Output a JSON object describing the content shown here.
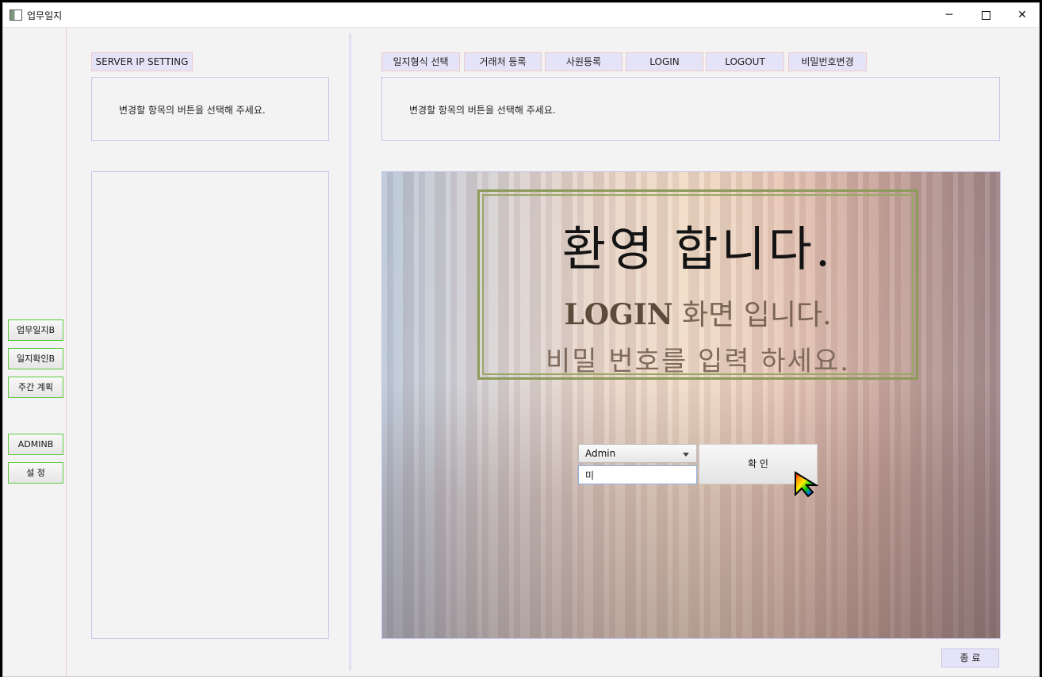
{
  "window": {
    "title": "업무일지"
  },
  "left_rail": {
    "buttons": [
      "업무일지B",
      "일지확인B",
      "주간 계획",
      "ADMINB",
      "설    정"
    ]
  },
  "server_section": {
    "button_label": "SERVER IP SETTING",
    "info_text": "변경할 항목의 버튼을 선택해 주세요."
  },
  "tabs": [
    "일지형식 선택",
    "거래처 등록",
    "사원등록",
    "LOGIN",
    "LOGOUT",
    "비밀번호변경"
  ],
  "main_info": {
    "text": "변경할 항목의 버튼을 선택해 주세요."
  },
  "welcome": {
    "title": "환영 합니다.",
    "line1_strong": "LOGIN",
    "line1_rest": " 화면 입니다.",
    "line2": "비밀 번호를 입력 하세요."
  },
  "login_form": {
    "user_selected": "Admin",
    "password_value": "미",
    "confirm_label": "확 인"
  },
  "footer": {
    "exit_label": "종    료"
  },
  "colors": {
    "tab_bg": "#e5e3f7",
    "side_button_border": "#5cc93e",
    "frame_green": "#8c9a5a"
  }
}
